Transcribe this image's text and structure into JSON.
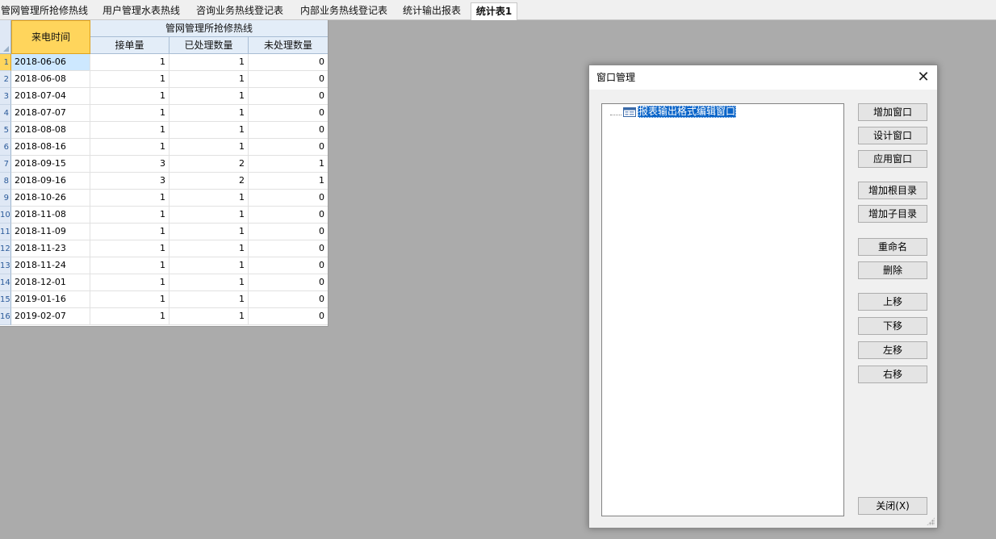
{
  "tabs": [
    {
      "label": "管网管理所抢修热线",
      "active": false
    },
    {
      "label": "用户管理水表热线",
      "active": false
    },
    {
      "label": "咨询业务热线登记表",
      "active": false
    },
    {
      "label": "内部业务热线登记表",
      "active": false
    },
    {
      "label": "统计输出报表",
      "active": false
    },
    {
      "label": "统计表1",
      "active": true
    }
  ],
  "grid": {
    "header_time": "来电时间",
    "header_group": "管网管理所抢修热线",
    "columns": [
      "接单量",
      "已处理数量",
      "未处理数量"
    ],
    "rows": [
      {
        "num": "1",
        "date": "2018-06-06",
        "received": "1",
        "processed": "1",
        "unprocessed": "0"
      },
      {
        "num": "2",
        "date": "2018-06-08",
        "received": "1",
        "processed": "1",
        "unprocessed": "0"
      },
      {
        "num": "3",
        "date": "2018-07-04",
        "received": "1",
        "processed": "1",
        "unprocessed": "0"
      },
      {
        "num": "4",
        "date": "2018-07-07",
        "received": "1",
        "processed": "1",
        "unprocessed": "0"
      },
      {
        "num": "5",
        "date": "2018-08-08",
        "received": "1",
        "processed": "1",
        "unprocessed": "0"
      },
      {
        "num": "6",
        "date": "2018-08-16",
        "received": "1",
        "processed": "1",
        "unprocessed": "0"
      },
      {
        "num": "7",
        "date": "2018-09-15",
        "received": "3",
        "processed": "2",
        "unprocessed": "1"
      },
      {
        "num": "8",
        "date": "2018-09-16",
        "received": "3",
        "processed": "2",
        "unprocessed": "1"
      },
      {
        "num": "9",
        "date": "2018-10-26",
        "received": "1",
        "processed": "1",
        "unprocessed": "0"
      },
      {
        "num": "10",
        "date": "2018-11-08",
        "received": "1",
        "processed": "1",
        "unprocessed": "0"
      },
      {
        "num": "11",
        "date": "2018-11-09",
        "received": "1",
        "processed": "1",
        "unprocessed": "0"
      },
      {
        "num": "12",
        "date": "2018-11-23",
        "received": "1",
        "processed": "1",
        "unprocessed": "0"
      },
      {
        "num": "13",
        "date": "2018-11-24",
        "received": "1",
        "processed": "1",
        "unprocessed": "0"
      },
      {
        "num": "14",
        "date": "2018-12-01",
        "received": "1",
        "processed": "1",
        "unprocessed": "0"
      },
      {
        "num": "15",
        "date": "2019-01-16",
        "received": "1",
        "processed": "1",
        "unprocessed": "0"
      },
      {
        "num": "16",
        "date": "2019-02-07",
        "received": "1",
        "processed": "1",
        "unprocessed": "0"
      }
    ]
  },
  "dialog": {
    "title": "窗口管理",
    "close_glyph": "✕",
    "tree_node_label": "报表输出格式编辑窗口",
    "tree_node_icon": "window-form-icon",
    "buttons": {
      "add_window": "增加窗口",
      "design_window": "设计窗口",
      "apply_window": "应用窗口",
      "add_root_dir": "增加根目录",
      "add_sub_dir": "增加子目录",
      "rename": "重命名",
      "delete": "删除",
      "move_up": "上移",
      "move_down": "下移",
      "move_left": "左移",
      "move_right": "右移",
      "close": "关闭(X)"
    }
  },
  "colors": {
    "selected_header": "#ffd55c",
    "tree_selection": "#0a64c8",
    "workspace": "#ababab"
  }
}
